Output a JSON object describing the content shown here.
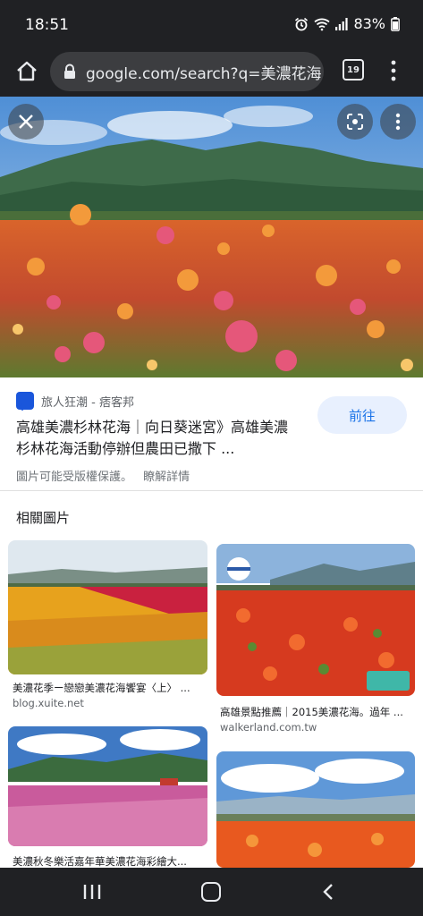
{
  "status_bar": {
    "time": "18:51",
    "battery": "83%",
    "icons": [
      "alarm-icon",
      "wifi-icon",
      "signal-icon",
      "battery-icon"
    ]
  },
  "browser": {
    "url": "google.com/search?q=美濃花海",
    "tab_count": "19",
    "icons": [
      "home-icon",
      "lock-icon",
      "tabs-icon",
      "more-vert-icon"
    ]
  },
  "hero": {
    "icons": [
      "close-icon",
      "lens-icon",
      "more-vert-icon"
    ]
  },
  "result": {
    "source_name": "旅人狂潮 - 痞客邦",
    "title": "高雄美濃杉林花海｜向日葵迷宮》高雄美濃杉林花海活動停辦但農田已撒下 ...",
    "visit_label": "前往",
    "copyright_notice": "圖片可能受版權保護。",
    "learn_more": "瞭解詳情"
  },
  "related": {
    "heading": "相關圖片",
    "items": [
      {
        "caption": "美濃花季ー戀戀美濃花海饗宴〈上〉 ...",
        "domain": "blog.xuite.net"
      },
      {
        "caption": "高雄景點推薦｜2015美濃花海。過年 ...",
        "domain": "walkerland.com.tw"
      },
      {
        "caption": "美濃秋冬樂活嘉年華美濃花海彩繪大...",
        "domain": ""
      },
      {
        "caption": "",
        "domain": ""
      }
    ]
  },
  "colors": {
    "chrome_dark": "#202124",
    "accent": "#1a73e8",
    "button_bg": "#e8f0fe"
  }
}
